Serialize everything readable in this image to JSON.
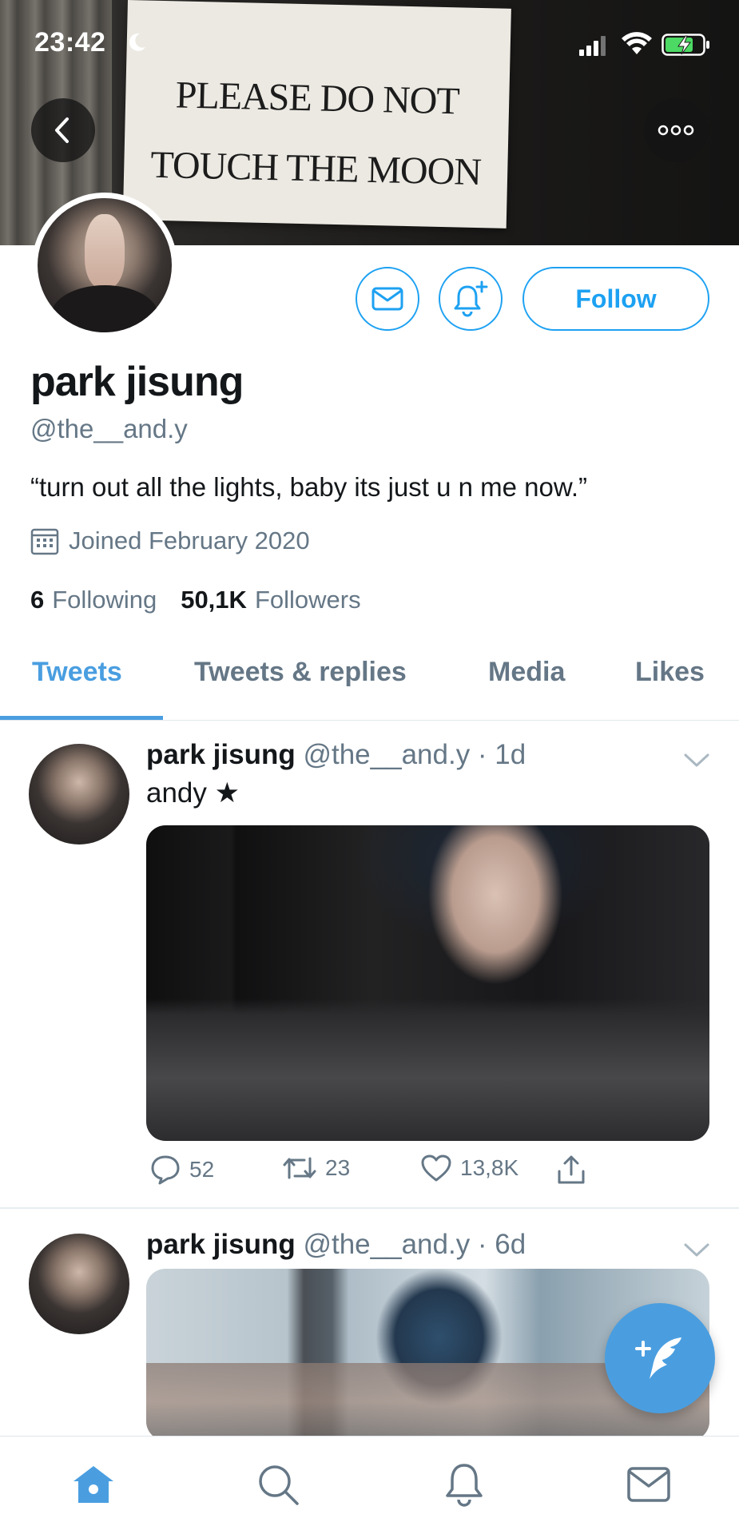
{
  "status_bar": {
    "time": "23:42",
    "moon_icon": "moon-icon",
    "signal_icon": "cellular-signal-icon",
    "wifi_icon": "wifi-icon",
    "battery_icon": "battery-charging-icon"
  },
  "header": {
    "banner_sign_line1": "PLEASE DO NOT",
    "banner_sign_line2": "TOUCH THE MOON",
    "back_icon": "back-arrow-icon",
    "more_icon": "more-options-icon"
  },
  "profile": {
    "display_name": "park jisung",
    "handle": "@the__and.y",
    "bio": "“turn out all the lights, baby its just u n me now.”",
    "joined": "Joined February 2020",
    "following_count": "6",
    "following_label": "Following",
    "followers_count": "50,1K",
    "followers_label": "Followers",
    "follow_button": "Follow"
  },
  "tabs": [
    {
      "label": "Tweets",
      "active": true
    },
    {
      "label": "Tweets & replies",
      "active": false
    },
    {
      "label": "Media",
      "active": false
    },
    {
      "label": "Likes",
      "active": false
    }
  ],
  "tweets": [
    {
      "name": "park jisung",
      "handle_time": "@the__and.y · 1d",
      "text": "andy ★",
      "replies": "52",
      "retweets": "23",
      "likes": "13,8K"
    },
    {
      "name": "park jisung",
      "handle_time": "@the__and.y · 6d"
    }
  ],
  "colors": {
    "accent": "#1da1f2",
    "tab_active": "#4a9ee0",
    "secondary_text": "#657786"
  },
  "bottom_nav": [
    "home-icon",
    "search-icon",
    "notifications-icon",
    "messages-icon"
  ]
}
